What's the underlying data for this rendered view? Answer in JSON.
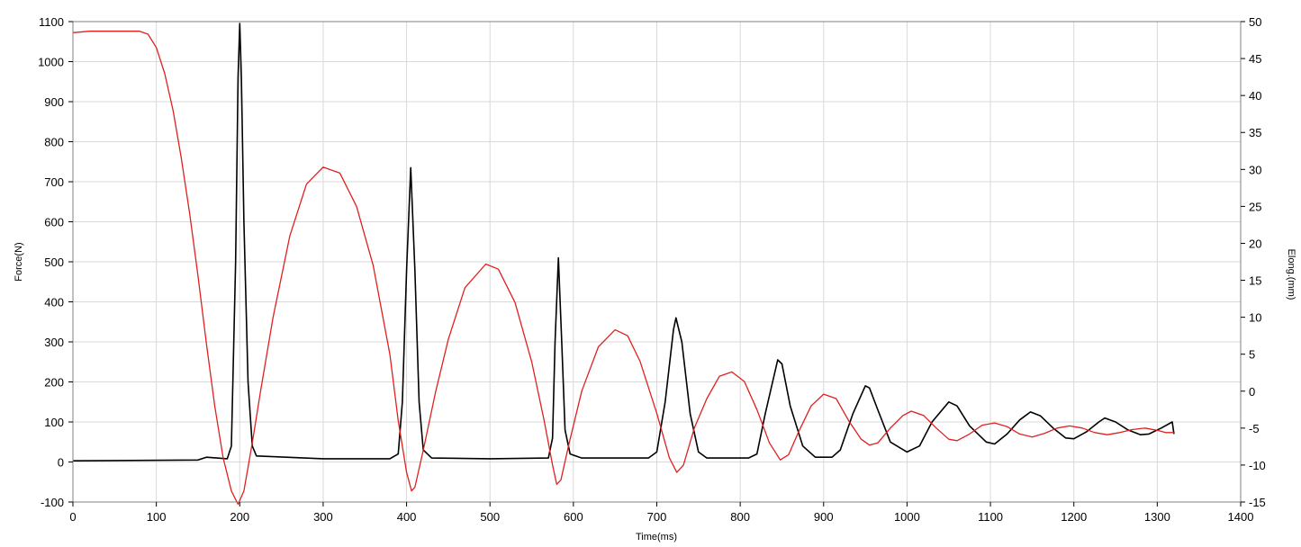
{
  "chart_data": {
    "type": "line",
    "title": "",
    "xlabel": "Time(ms)",
    "ylabel_left": "Force(N)",
    "ylabel_right": "Elong.(mm)",
    "xlim": [
      0,
      1400
    ],
    "ylim_left": [
      -100,
      1100
    ],
    "ylim_right": [
      -15,
      50
    ],
    "x_ticks": [
      0,
      100,
      200,
      300,
      400,
      500,
      600,
      700,
      800,
      900,
      1000,
      1100,
      1200,
      1300,
      1400
    ],
    "y_left_ticks": [
      -100,
      0,
      100,
      200,
      300,
      400,
      500,
      600,
      700,
      800,
      900,
      1000,
      1100
    ],
    "y_right_ticks": [
      -15,
      -10,
      -5,
      0,
      5,
      10,
      15,
      20,
      25,
      30,
      35,
      40,
      45,
      50
    ],
    "grid": true,
    "legend": "none",
    "series": [
      {
        "axis": "left",
        "color": "#000000",
        "points": [
          [
            0,
            3
          ],
          [
            150,
            5
          ],
          [
            160,
            12
          ],
          [
            185,
            8
          ],
          [
            190,
            40
          ],
          [
            195,
            500
          ],
          [
            198,
            960
          ],
          [
            200,
            1095
          ],
          [
            202,
            960
          ],
          [
            205,
            600
          ],
          [
            210,
            200
          ],
          [
            215,
            40
          ],
          [
            220,
            15
          ],
          [
            300,
            8
          ],
          [
            380,
            8
          ],
          [
            390,
            20
          ],
          [
            395,
            150
          ],
          [
            400,
            480
          ],
          [
            405,
            735
          ],
          [
            410,
            480
          ],
          [
            415,
            150
          ],
          [
            420,
            30
          ],
          [
            430,
            10
          ],
          [
            500,
            8
          ],
          [
            570,
            10
          ],
          [
            575,
            60
          ],
          [
            578,
            300
          ],
          [
            582,
            510
          ],
          [
            586,
            300
          ],
          [
            590,
            80
          ],
          [
            596,
            20
          ],
          [
            610,
            10
          ],
          [
            690,
            10
          ],
          [
            700,
            25
          ],
          [
            710,
            150
          ],
          [
            720,
            330
          ],
          [
            723,
            360
          ],
          [
            730,
            300
          ],
          [
            740,
            120
          ],
          [
            750,
            25
          ],
          [
            760,
            10
          ],
          [
            810,
            10
          ],
          [
            820,
            20
          ],
          [
            830,
            120
          ],
          [
            845,
            255
          ],
          [
            850,
            245
          ],
          [
            860,
            140
          ],
          [
            875,
            40
          ],
          [
            890,
            12
          ],
          [
            910,
            12
          ],
          [
            920,
            30
          ],
          [
            935,
            120
          ],
          [
            950,
            190
          ],
          [
            955,
            185
          ],
          [
            965,
            130
          ],
          [
            980,
            50
          ],
          [
            1000,
            25
          ],
          [
            1015,
            40
          ],
          [
            1030,
            100
          ],
          [
            1050,
            150
          ],
          [
            1060,
            140
          ],
          [
            1075,
            90
          ],
          [
            1095,
            50
          ],
          [
            1105,
            45
          ],
          [
            1120,
            70
          ],
          [
            1135,
            105
          ],
          [
            1148,
            125
          ],
          [
            1160,
            115
          ],
          [
            1175,
            85
          ],
          [
            1190,
            60
          ],
          [
            1200,
            58
          ],
          [
            1215,
            75
          ],
          [
            1230,
            100
          ],
          [
            1237,
            110
          ],
          [
            1250,
            100
          ],
          [
            1265,
            80
          ],
          [
            1280,
            68
          ],
          [
            1290,
            70
          ],
          [
            1305,
            85
          ],
          [
            1318,
            100
          ],
          [
            1320,
            70
          ]
        ]
      },
      {
        "axis": "right",
        "color": "#e02020",
        "points": [
          [
            0,
            48.5
          ],
          [
            20,
            48.7
          ],
          [
            80,
            48.7
          ],
          [
            90,
            48.3
          ],
          [
            100,
            46.5
          ],
          [
            110,
            43
          ],
          [
            120,
            38
          ],
          [
            130,
            31.5
          ],
          [
            140,
            24
          ],
          [
            150,
            15.5
          ],
          [
            160,
            6.5
          ],
          [
            170,
            -2
          ],
          [
            180,
            -9
          ],
          [
            190,
            -13.5
          ],
          [
            198,
            -15.3
          ],
          [
            205,
            -13.5
          ],
          [
            215,
            -7
          ],
          [
            225,
            0
          ],
          [
            240,
            10
          ],
          [
            260,
            21
          ],
          [
            280,
            28
          ],
          [
            300,
            30.3
          ],
          [
            320,
            29.5
          ],
          [
            340,
            25
          ],
          [
            360,
            17
          ],
          [
            380,
            5
          ],
          [
            390,
            -4
          ],
          [
            400,
            -11
          ],
          [
            406,
            -13.5
          ],
          [
            410,
            -13
          ],
          [
            420,
            -8
          ],
          [
            435,
            0
          ],
          [
            450,
            7
          ],
          [
            470,
            14
          ],
          [
            495,
            17.2
          ],
          [
            510,
            16.5
          ],
          [
            530,
            12
          ],
          [
            550,
            4
          ],
          [
            565,
            -4
          ],
          [
            575,
            -10
          ],
          [
            580,
            -12.6
          ],
          [
            585,
            -12
          ],
          [
            595,
            -7
          ],
          [
            610,
            0
          ],
          [
            630,
            6
          ],
          [
            650,
            8.3
          ],
          [
            665,
            7.5
          ],
          [
            680,
            4
          ],
          [
            700,
            -3
          ],
          [
            715,
            -9
          ],
          [
            724,
            -11
          ],
          [
            732,
            -10
          ],
          [
            745,
            -5
          ],
          [
            760,
            -1
          ],
          [
            775,
            2
          ],
          [
            790,
            2.6
          ],
          [
            805,
            1.3
          ],
          [
            820,
            -2.5
          ],
          [
            835,
            -7
          ],
          [
            848,
            -9.3
          ],
          [
            858,
            -8.6
          ],
          [
            870,
            -5.5
          ],
          [
            885,
            -2
          ],
          [
            900,
            -0.4
          ],
          [
            915,
            -1
          ],
          [
            930,
            -4
          ],
          [
            945,
            -6.5
          ],
          [
            955,
            -7.3
          ],
          [
            965,
            -7
          ],
          [
            980,
            -5
          ],
          [
            995,
            -3.3
          ],
          [
            1005,
            -2.7
          ],
          [
            1020,
            -3.3
          ],
          [
            1035,
            -5
          ],
          [
            1050,
            -6.5
          ],
          [
            1060,
            -6.7
          ],
          [
            1075,
            -5.8
          ],
          [
            1090,
            -4.6
          ],
          [
            1105,
            -4.3
          ],
          [
            1120,
            -4.8
          ],
          [
            1135,
            -5.8
          ],
          [
            1150,
            -6.2
          ],
          [
            1165,
            -5.7
          ],
          [
            1180,
            -5
          ],
          [
            1195,
            -4.7
          ],
          [
            1210,
            -5
          ],
          [
            1225,
            -5.6
          ],
          [
            1240,
            -5.9
          ],
          [
            1255,
            -5.6
          ],
          [
            1270,
            -5.2
          ],
          [
            1285,
            -5
          ],
          [
            1300,
            -5.3
          ],
          [
            1310,
            -5.6
          ],
          [
            1320,
            -5.6
          ]
        ]
      }
    ]
  }
}
